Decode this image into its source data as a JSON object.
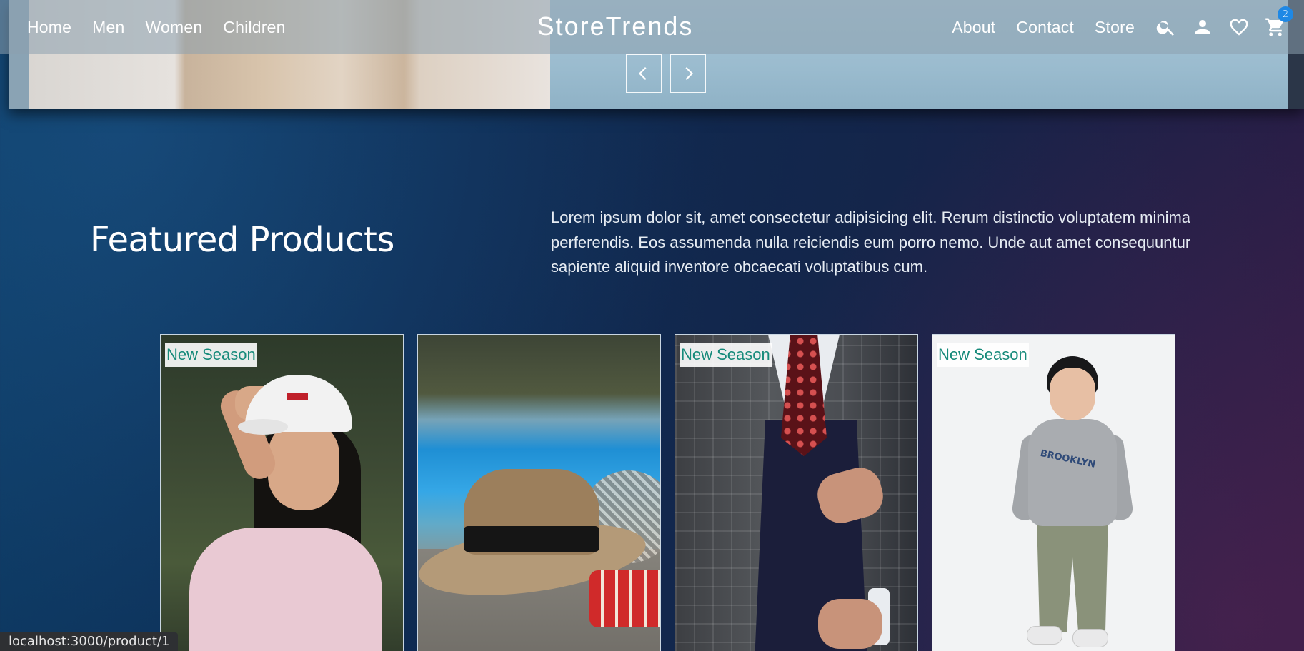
{
  "nav": {
    "left_links": [
      "Home",
      "Men",
      "Women",
      "Children"
    ],
    "brand": "StoreTrends",
    "right_links": [
      "About",
      "Contact",
      "Store"
    ],
    "icons": [
      "search-icon",
      "account-icon",
      "wishlist-icon",
      "cart-icon"
    ],
    "cart_count": "2"
  },
  "hero": {
    "prev_icon": "chevron-left-icon",
    "next_icon": "chevron-right-icon"
  },
  "featured": {
    "title": "Featured Products",
    "description": "Lorem ipsum dolor sit, amet consectetur adipisicing elit. Rerum distinctio voluptatem minima perferendis. Eos assumenda nulla reiciendis eum porro nemo. Unde aut amet consequuntur sapiente aliquid inventore obcaecati voluptatibus cum."
  },
  "products": [
    {
      "badge": "New Season",
      "image": "woman-white-cap-pink-tshirt"
    },
    {
      "badge": "",
      "image": "straw-fedora-hat-by-pool"
    },
    {
      "badge": "New Season",
      "image": "man-plaid-suit-red-tie"
    },
    {
      "badge": "New Season",
      "image": "boy-brooklyn-sweatshirt"
    }
  ],
  "status_bar": {
    "url": "localhost:3000/product/1"
  },
  "colors": {
    "accent_badge_text": "#168a7a",
    "cart_badge": "#1e88e5"
  }
}
